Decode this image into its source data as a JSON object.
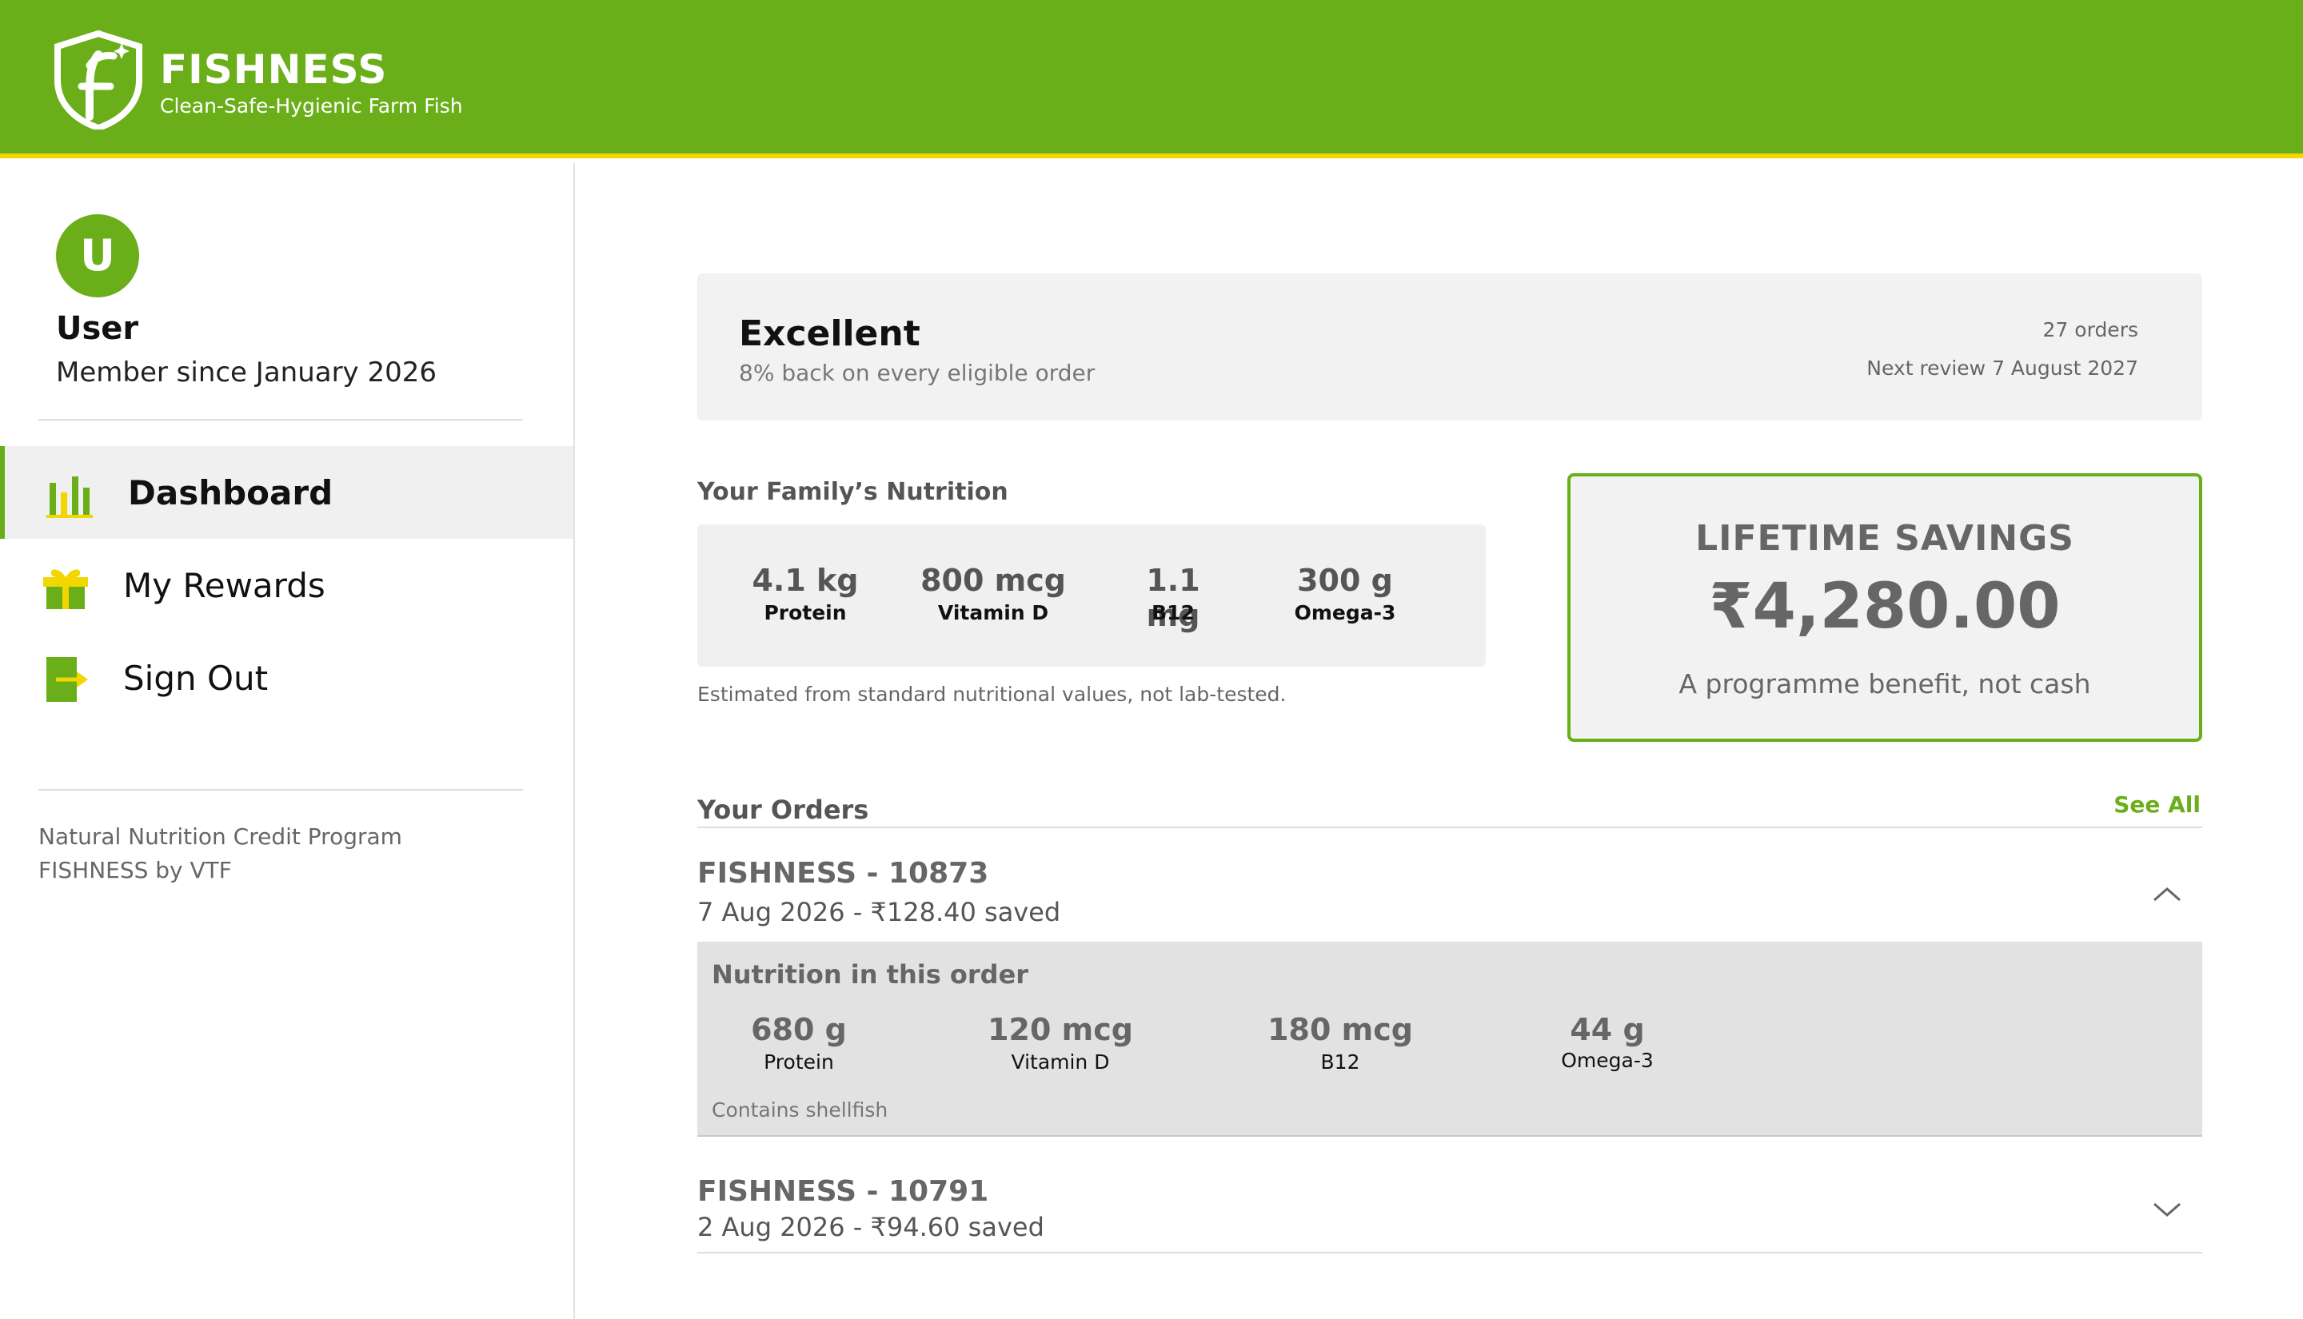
{
  "brand": {
    "name": "FISHNESS",
    "tagline": "Clean-Safe-Hygienic Farm Fish",
    "accent": "#6aaf19",
    "stripe": "#f2d600"
  },
  "user": {
    "initial": "U",
    "name": "User",
    "member_since": "Member since January 2026"
  },
  "nav": {
    "items": [
      {
        "label": "Dashboard",
        "icon": "bar-chart-icon",
        "active": true
      },
      {
        "label": "My Rewards",
        "icon": "gift-icon",
        "active": false
      },
      {
        "label": "Sign Out",
        "icon": "sign-out-icon",
        "active": false
      }
    ]
  },
  "sidebar_footer": {
    "line1": "Natural Nutrition Credit Program",
    "line2": "FISHNESS by VTF"
  },
  "tier": {
    "name": "Excellent",
    "subtitle": "8% back on every eligible order",
    "orders": "27 orders",
    "next_review": "Next review 7 August 2027"
  },
  "nutrition": {
    "title": "Your Family’s Nutrition",
    "items": [
      {
        "value": "4.1 kg",
        "label": "Protein"
      },
      {
        "value": "800 mcg",
        "label": "Vitamin D"
      },
      {
        "value": "1.1 mg",
        "label": "B12"
      },
      {
        "value": "300 g",
        "label": "Omega-3"
      }
    ],
    "note": "Estimated from standard nutritional values, not lab-tested."
  },
  "savings": {
    "title": "LIFETIME SAVINGS",
    "amount": "₹4,280.00",
    "note": "A programme benefit, not cash"
  },
  "orders": {
    "title": "Your Orders",
    "see_all": "See All",
    "list": [
      {
        "id": "FISHNESS - 10873",
        "meta": "7 Aug 2026 - ₹128.40 saved",
        "expanded": true,
        "detail": {
          "title": "Nutrition in this order",
          "items": [
            {
              "value": "680 g",
              "label": "Protein"
            },
            {
              "value": "120 mcg",
              "label": "Vitamin D"
            },
            {
              "value": "180 mcg",
              "label": "B12"
            },
            {
              "value": "44 g",
              "label": "Omega-3"
            }
          ],
          "note": "Contains shellfish"
        }
      },
      {
        "id": "FISHNESS - 10791",
        "meta": "2 Aug 2026 - ₹94.60 saved",
        "expanded": false
      }
    ]
  }
}
